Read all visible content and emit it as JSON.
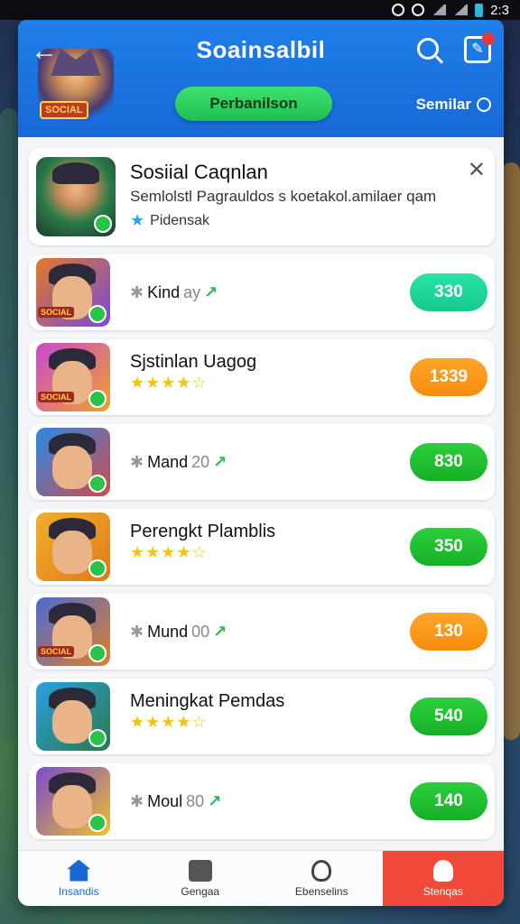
{
  "status_bar": {
    "time": "2:3"
  },
  "header": {
    "title": "Soainsalbil",
    "back_icon": "back-arrow-icon",
    "brand_label": "SOCIAL",
    "pill_label": "Perbanilson",
    "right_label": "Semilar"
  },
  "featured": {
    "title": "Sosiial Caqnlan",
    "subtitle": "Semlolstl Pagrauldos s koetakol.amilaer qam",
    "tag": "Pidensak"
  },
  "rows": [
    {
      "name": "",
      "meta_label": "Kind",
      "meta_value": "ay",
      "stars": "",
      "button": "330",
      "button_style": "teal",
      "thumb_label": "SOCIAL"
    },
    {
      "name": "Sjstinlan Uagog",
      "meta_label": "",
      "meta_value": "",
      "stars": "★★★★☆",
      "button": "1339",
      "button_style": "orange",
      "thumb_label": "SOCIAL"
    },
    {
      "name": "",
      "meta_label": "Mand",
      "meta_value": "20",
      "stars": "",
      "button": "830",
      "button_style": "green",
      "thumb_label": ""
    },
    {
      "name": "Perengkt Plamblis",
      "meta_label": "",
      "meta_value": "",
      "stars": "★★★★☆",
      "button": "350",
      "button_style": "green",
      "thumb_label": ""
    },
    {
      "name": "",
      "meta_label": "Mund",
      "meta_value": "00",
      "stars": "",
      "button": "130",
      "button_style": "orange",
      "thumb_label": "SOCIAL"
    },
    {
      "name": "Meningkat Pemdas",
      "meta_label": "",
      "meta_value": "",
      "stars": "★★★★☆",
      "button": "540",
      "button_style": "green",
      "thumb_label": ""
    },
    {
      "name": "",
      "meta_label": "Moul",
      "meta_value": "80",
      "stars": "",
      "button": "140",
      "button_style": "green",
      "thumb_label": ""
    }
  ],
  "nav": [
    {
      "label": "Insandis",
      "icon": "home-icon"
    },
    {
      "label": "Gengaa",
      "icon": "list-icon"
    },
    {
      "label": "Ebenselins",
      "icon": "people-icon"
    },
    {
      "label": "Stenqas",
      "icon": "user-icon"
    }
  ],
  "colors": {
    "primary": "#1869d8",
    "accent_green": "#1fbf4f",
    "accent_orange": "#f58d0e",
    "accent_teal": "#18c98e",
    "nav_red": "#f14a3a"
  }
}
